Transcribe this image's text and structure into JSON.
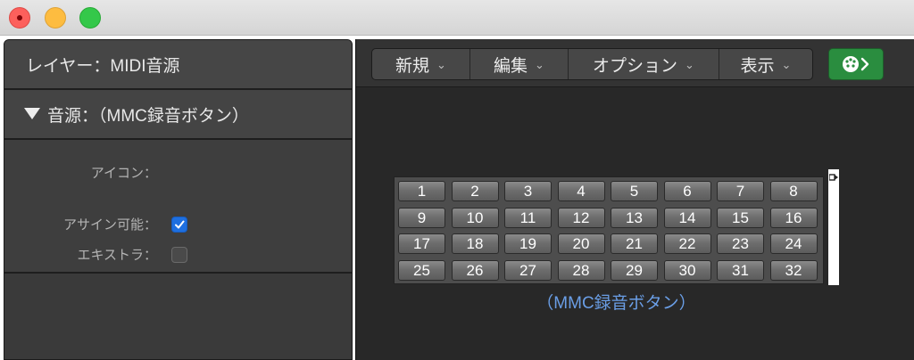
{
  "window": {
    "controls": [
      "close",
      "minimize",
      "zoom"
    ]
  },
  "inspector": {
    "layer_title": "レイヤー：MIDI音源",
    "section_label": "音源：（MMC録音ボタン）",
    "params": {
      "icon_label": "アイコン：",
      "assignable_label": "アサイン可能：",
      "assignable_checked": true,
      "extra_label": "エキストラ：",
      "extra_checked": false
    }
  },
  "toolbar": {
    "menus": [
      {
        "label": "新規",
        "chevron": "⌄"
      },
      {
        "label": "編集",
        "chevron": "⌄"
      },
      {
        "label": "オプション",
        "chevron": "⌄"
      },
      {
        "label": "表示",
        "chevron": "⌄"
      }
    ],
    "midi_button_icon": "midi-plug-arrow-icon",
    "midi_button_color": "#2a8d3f"
  },
  "mmc_object": {
    "buttons": [
      "1",
      "2",
      "3",
      "4",
      "5",
      "6",
      "7",
      "8",
      "9",
      "10",
      "11",
      "12",
      "13",
      "14",
      "15",
      "16",
      "17",
      "18",
      "19",
      "20",
      "21",
      "22",
      "23",
      "24",
      "25",
      "26",
      "27",
      "28",
      "29",
      "30",
      "31",
      "32"
    ],
    "name": "（MMC録音ボタン）",
    "name_color": "#6a9ee6"
  }
}
